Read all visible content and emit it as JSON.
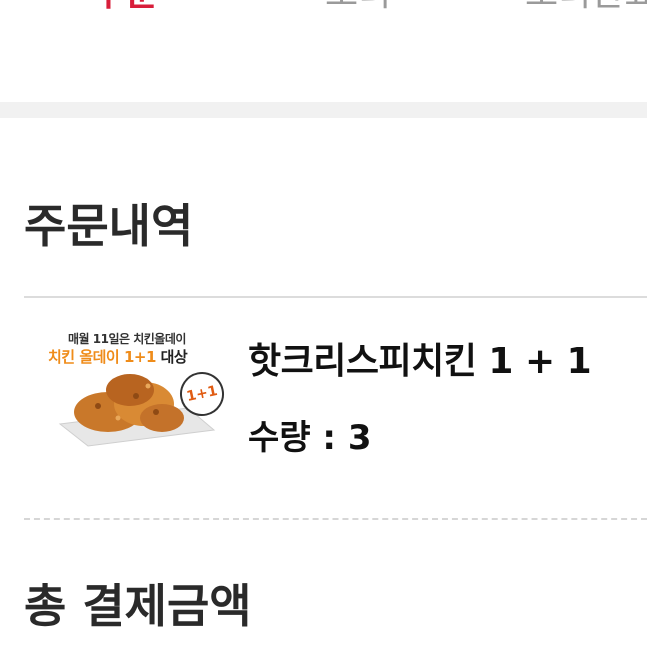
{
  "tabs": [
    {
      "label": "주문",
      "active": true
    },
    {
      "label": "조리",
      "active": false
    },
    {
      "label": "조리완료",
      "active": false
    }
  ],
  "colors": {
    "accent": "#d81e3a",
    "promo_orange": "#ef8c1a"
  },
  "order_section": {
    "title": "주문내역",
    "item": {
      "image": {
        "promo_line1": "매월 11일은 치킨올데이",
        "promo_line2_highlight": "치킨 올데이 1+1",
        "promo_line2_suffix": "대상",
        "stamp_text": "1+1",
        "icon": "fried-chicken-image"
      },
      "name": "핫크리스피치킨 1 + 1",
      "quantity_text": "수량 : 3"
    }
  },
  "total_section": {
    "title": "총 결제금액"
  }
}
